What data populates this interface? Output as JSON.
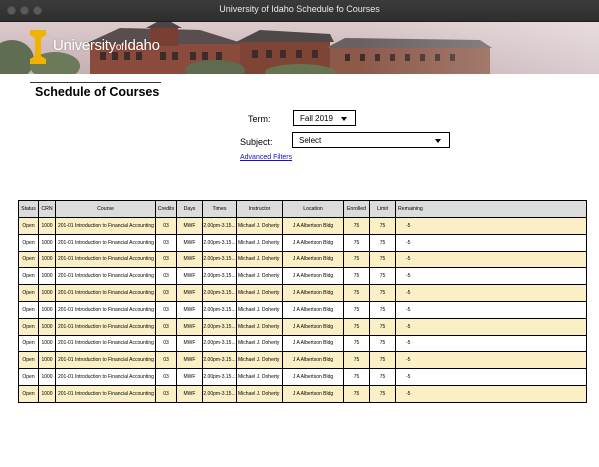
{
  "window": {
    "title": "University of Idaho Schedule fo Courses"
  },
  "banner": {
    "logo_main": "University",
    "logo_of": "of",
    "logo_idaho": "Idaho"
  },
  "page": {
    "heading": "Schedule of Courses"
  },
  "filters": {
    "term_label": "Term:",
    "term_value": "Fall 2019",
    "subject_label": "Subject:",
    "subject_value": "Select",
    "advanced_link": "Advanced Filters"
  },
  "colors": {
    "odd_row": "#fbefc6",
    "even_row": "#ffffff",
    "header_row": "#dcdcdc",
    "titlebar": "#333333"
  },
  "table": {
    "headers": [
      "Status",
      "CRN",
      "Course",
      "Credits",
      "Days",
      "Times",
      "Instructor",
      "Location",
      "Enrolled",
      "Limit",
      "Remaining"
    ],
    "rows": [
      [
        "Open",
        "1000",
        "201-01 Introduction to Financial Accounting",
        "03",
        "MWF",
        "2.00pm-3.15...",
        "Michael J. Doherty",
        "J A Albertson Bldg",
        "75",
        "75",
        "-5"
      ],
      [
        "Open",
        "1000",
        "201-01 Introduction to Financial Accounting",
        "03",
        "MWF",
        "2.00pm-3.15...",
        "Michael J. Doherty",
        "J A Albertson Bldg",
        "75",
        "75",
        "-5"
      ],
      [
        "Open",
        "1000",
        "201-01 Introduction to Financial Accounting",
        "03",
        "MWF",
        "2.00pm-3.15...",
        "Michael J. Doherty",
        "J A Albertson Bldg",
        "75",
        "75",
        "-5"
      ],
      [
        "Open",
        "1000",
        "201-01 Introduction to Financial Accounting",
        "03",
        "MWF",
        "2.00pm-3.15...",
        "Michael J. Doherty",
        "J A Albertson Bldg",
        "75",
        "75",
        "-5"
      ],
      [
        "Open",
        "1000",
        "201-01 Introduction to Financial Accounting",
        "03",
        "MWF",
        "2.00pm-3.15...",
        "Michael J. Doherty",
        "J A Albertson Bldg",
        "75",
        "75",
        "-5"
      ],
      [
        "Open",
        "1000",
        "201-01 Introduction to Financial Accounting",
        "03",
        "MWF",
        "2.00pm-3.15...",
        "Michael J. Doherty",
        "J A Albertson Bldg",
        "75",
        "75",
        "-5"
      ],
      [
        "Open",
        "1000",
        "201-01 Introduction to Financial Accounting",
        "03",
        "MWF",
        "2.00pm-3.15...",
        "Michael J. Doherty",
        "J A Albertson Bldg",
        "75",
        "75",
        "-5"
      ],
      [
        "Open",
        "1000",
        "201-01 Introduction to Financial Accounting",
        "03",
        "MWF",
        "2.00pm-3.15...",
        "Michael J. Doherty",
        "J A Albertson Bldg",
        "75",
        "75",
        "-5"
      ],
      [
        "Open",
        "1000",
        "201-01 Introduction to Financial Accounting",
        "03",
        "MWF",
        "2.00pm-3.15...",
        "Michael J. Doherty",
        "J A Albertson Bldg",
        "75",
        "75",
        "-5"
      ],
      [
        "Open",
        "1000",
        "201-01 Introduction to Financial Accounting",
        "03",
        "MWF",
        "2.00pm-3.15...",
        "Michael J. Doherty",
        "J A Albertson Bldg",
        "75",
        "75",
        "-5"
      ],
      [
        "Open",
        "1000",
        "201-01 Introduction to Financial Accounting",
        "03",
        "MWF",
        "2.00pm-3.15...",
        "Michael J. Doherty",
        "J A Albertson Bldg",
        "75",
        "75",
        "-5"
      ]
    ]
  }
}
